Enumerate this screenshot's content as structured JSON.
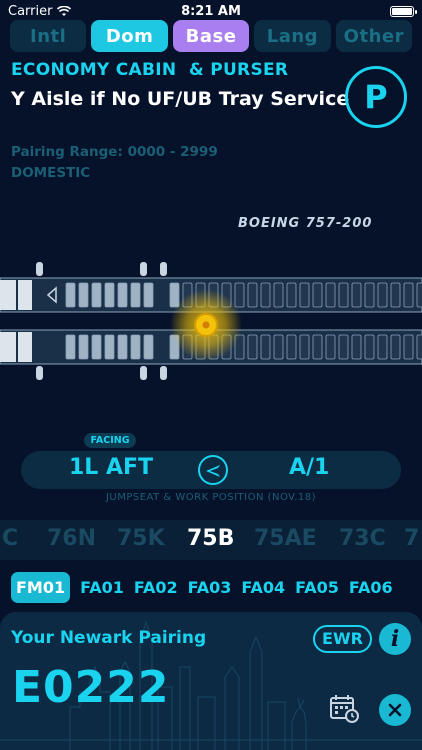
{
  "status_bar": {
    "carrier": "Carrier",
    "time": "8:21 AM"
  },
  "tabs": [
    {
      "label": "Intl",
      "state": "inactive"
    },
    {
      "label": "Dom",
      "state": "active"
    },
    {
      "label": "Base",
      "state": "active"
    },
    {
      "label": "Lang",
      "state": "inactive"
    },
    {
      "label": "Other",
      "state": "inactive"
    }
  ],
  "assignment": {
    "cabin": "ECONOMY CABIN  & PURSER",
    "service": "Y Aisle if No UF/UB Tray Service",
    "badge": "P",
    "pairing_range": "Pairing Range: 0000 - 2999",
    "category": "DOMESTIC"
  },
  "aircraft": {
    "name": "BOEING 757-200"
  },
  "jumpseat": {
    "facing_label": "FACING",
    "position": "1L AFT",
    "seat": "A/1",
    "caption": "JUMPSEAT  &  WORK POSITION  (NOV.18)"
  },
  "pairing_picker": {
    "items": [
      "C",
      "76N",
      "75K",
      "75B",
      "75AE",
      "73C",
      "7"
    ],
    "selected": "75B"
  },
  "positions": {
    "items": [
      "FM01",
      "FA01",
      "FA02",
      "FA03",
      "FA04",
      "FA05",
      "FA06"
    ],
    "selected": "FM01"
  },
  "pairing_card": {
    "title": "Your Newark Pairing",
    "code": "E0222",
    "airport": "EWR",
    "info_label": "i"
  },
  "colors": {
    "accent": "#19d3ef",
    "base_tab": "#a97ff0",
    "background": "#06122a",
    "highlight": "#f3c20a"
  }
}
